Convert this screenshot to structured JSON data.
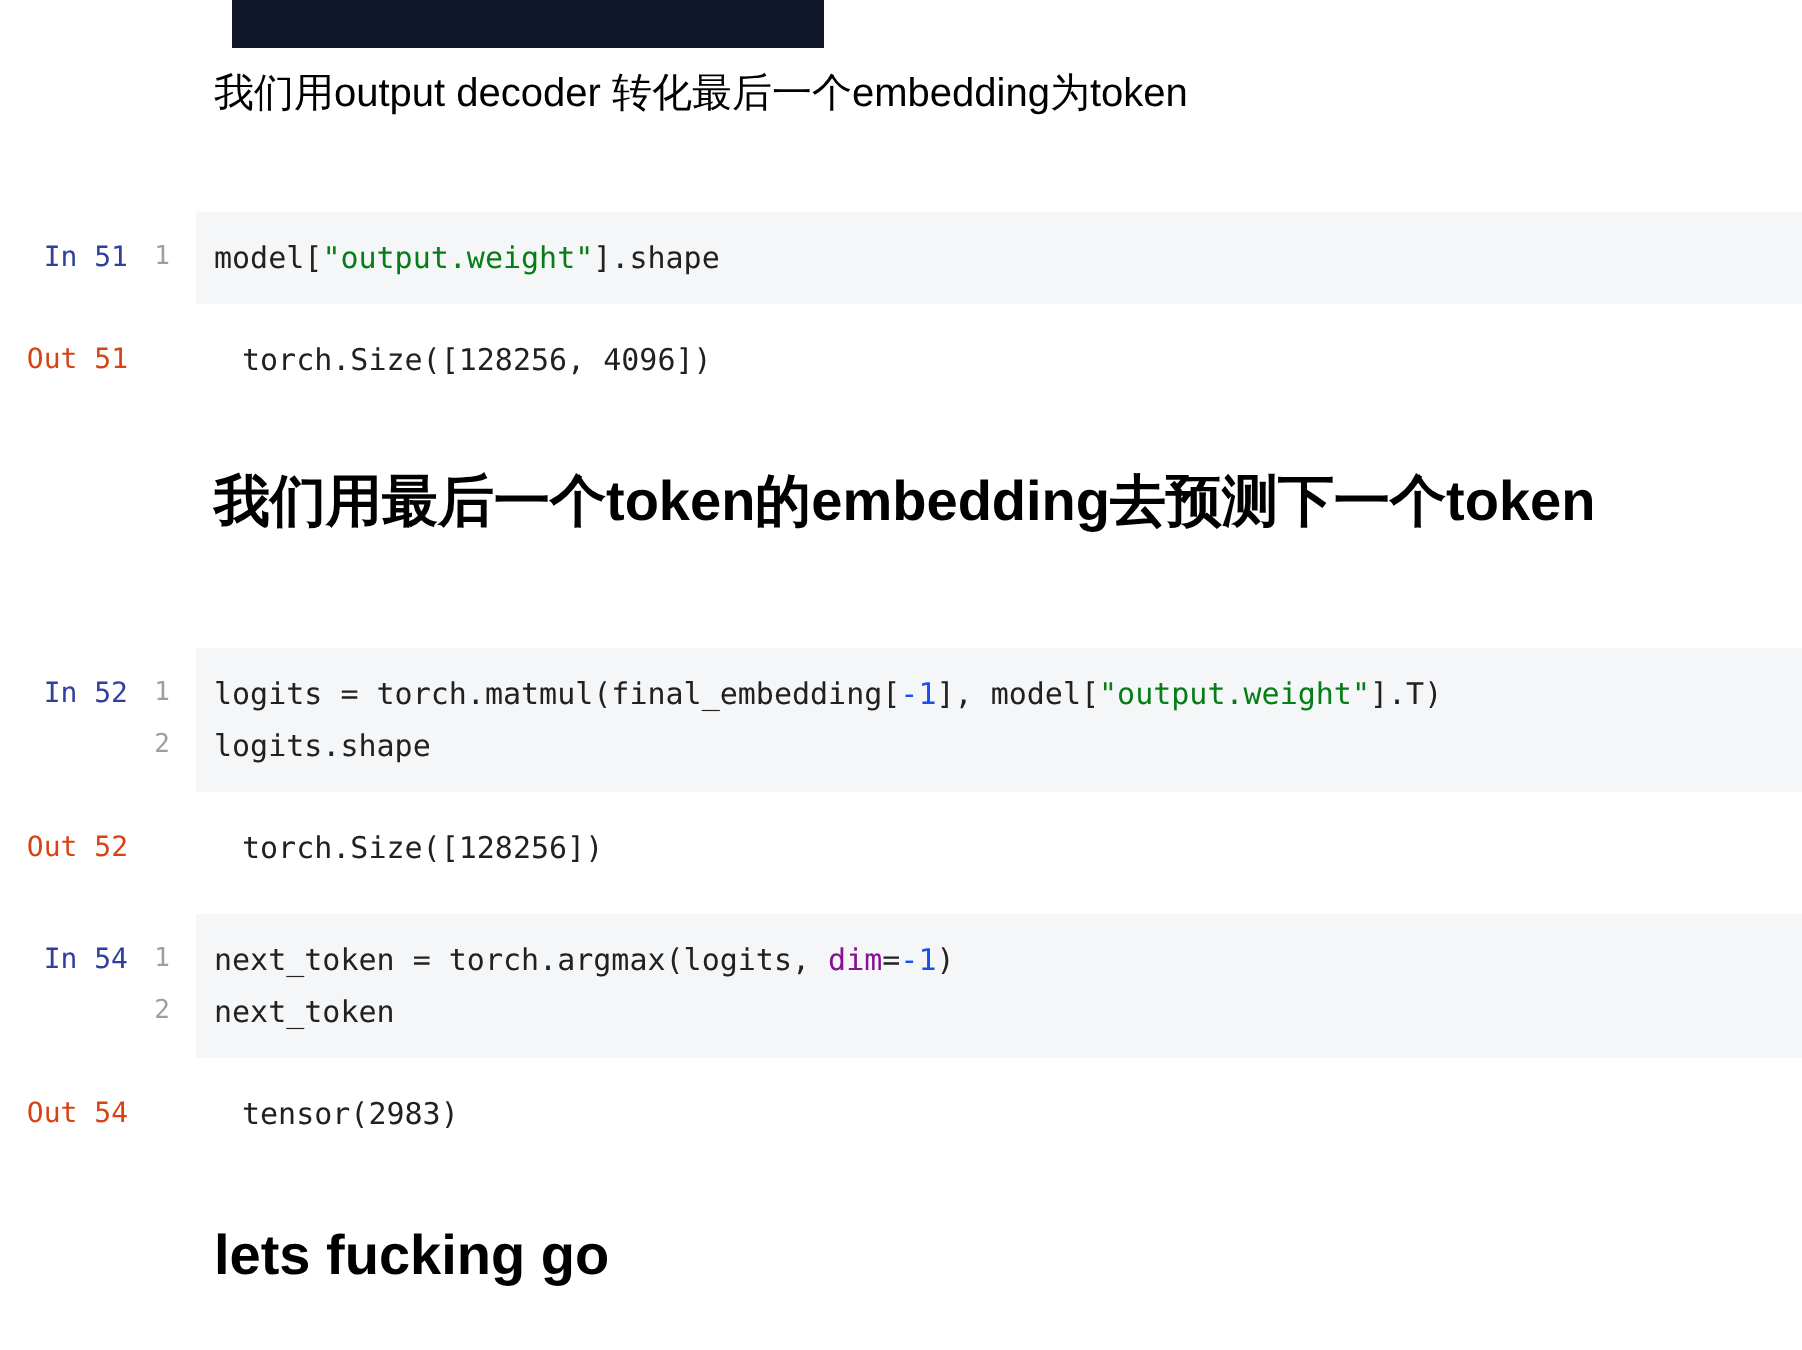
{
  "cells": [
    {
      "kind": "image"
    },
    {
      "kind": "markdown",
      "text": "我们用output decoder 转化最后一个embedding为token"
    },
    {
      "kind": "code",
      "prompt_in": "In 51",
      "lines": [
        {
          "number": "1",
          "tokens": [
            {
              "kind": "plain",
              "text": "model["
            },
            {
              "kind": "string",
              "text": "\"output.weight\""
            },
            {
              "kind": "plain",
              "text": "].shape"
            }
          ]
        }
      ],
      "prompt_out": "Out 51",
      "output": "torch.Size([128256, 4096])"
    },
    {
      "kind": "heading",
      "text": "我们用最后一个token的embedding去预测下一个token"
    },
    {
      "kind": "code",
      "prompt_in": "In 52",
      "lines": [
        {
          "number": "1",
          "tokens": [
            {
              "kind": "plain",
              "text": "logits = torch.matmul(final_embedding["
            },
            {
              "kind": "number",
              "text": "-1"
            },
            {
              "kind": "plain",
              "text": "], model["
            },
            {
              "kind": "string",
              "text": "\"output.weight\""
            },
            {
              "kind": "plain",
              "text": "].T)"
            }
          ]
        },
        {
          "number": "2",
          "tokens": [
            {
              "kind": "plain",
              "text": "logits.shape"
            }
          ]
        }
      ],
      "prompt_out": "Out 52",
      "output": "torch.Size([128256])"
    },
    {
      "kind": "code",
      "prompt_in": "In 54",
      "lines": [
        {
          "number": "1",
          "tokens": [
            {
              "kind": "plain",
              "text": "next_token = torch.argmax(logits, "
            },
            {
              "kind": "keyword",
              "text": "dim"
            },
            {
              "kind": "plain",
              "text": "="
            },
            {
              "kind": "number",
              "text": "-1"
            },
            {
              "kind": "plain",
              "text": ")"
            }
          ]
        },
        {
          "number": "2",
          "tokens": [
            {
              "kind": "plain",
              "text": "next_token"
            }
          ]
        }
      ],
      "prompt_out": "Out 54",
      "output": "tensor(2983)"
    },
    {
      "kind": "heading",
      "text": "lets fucking go"
    }
  ]
}
